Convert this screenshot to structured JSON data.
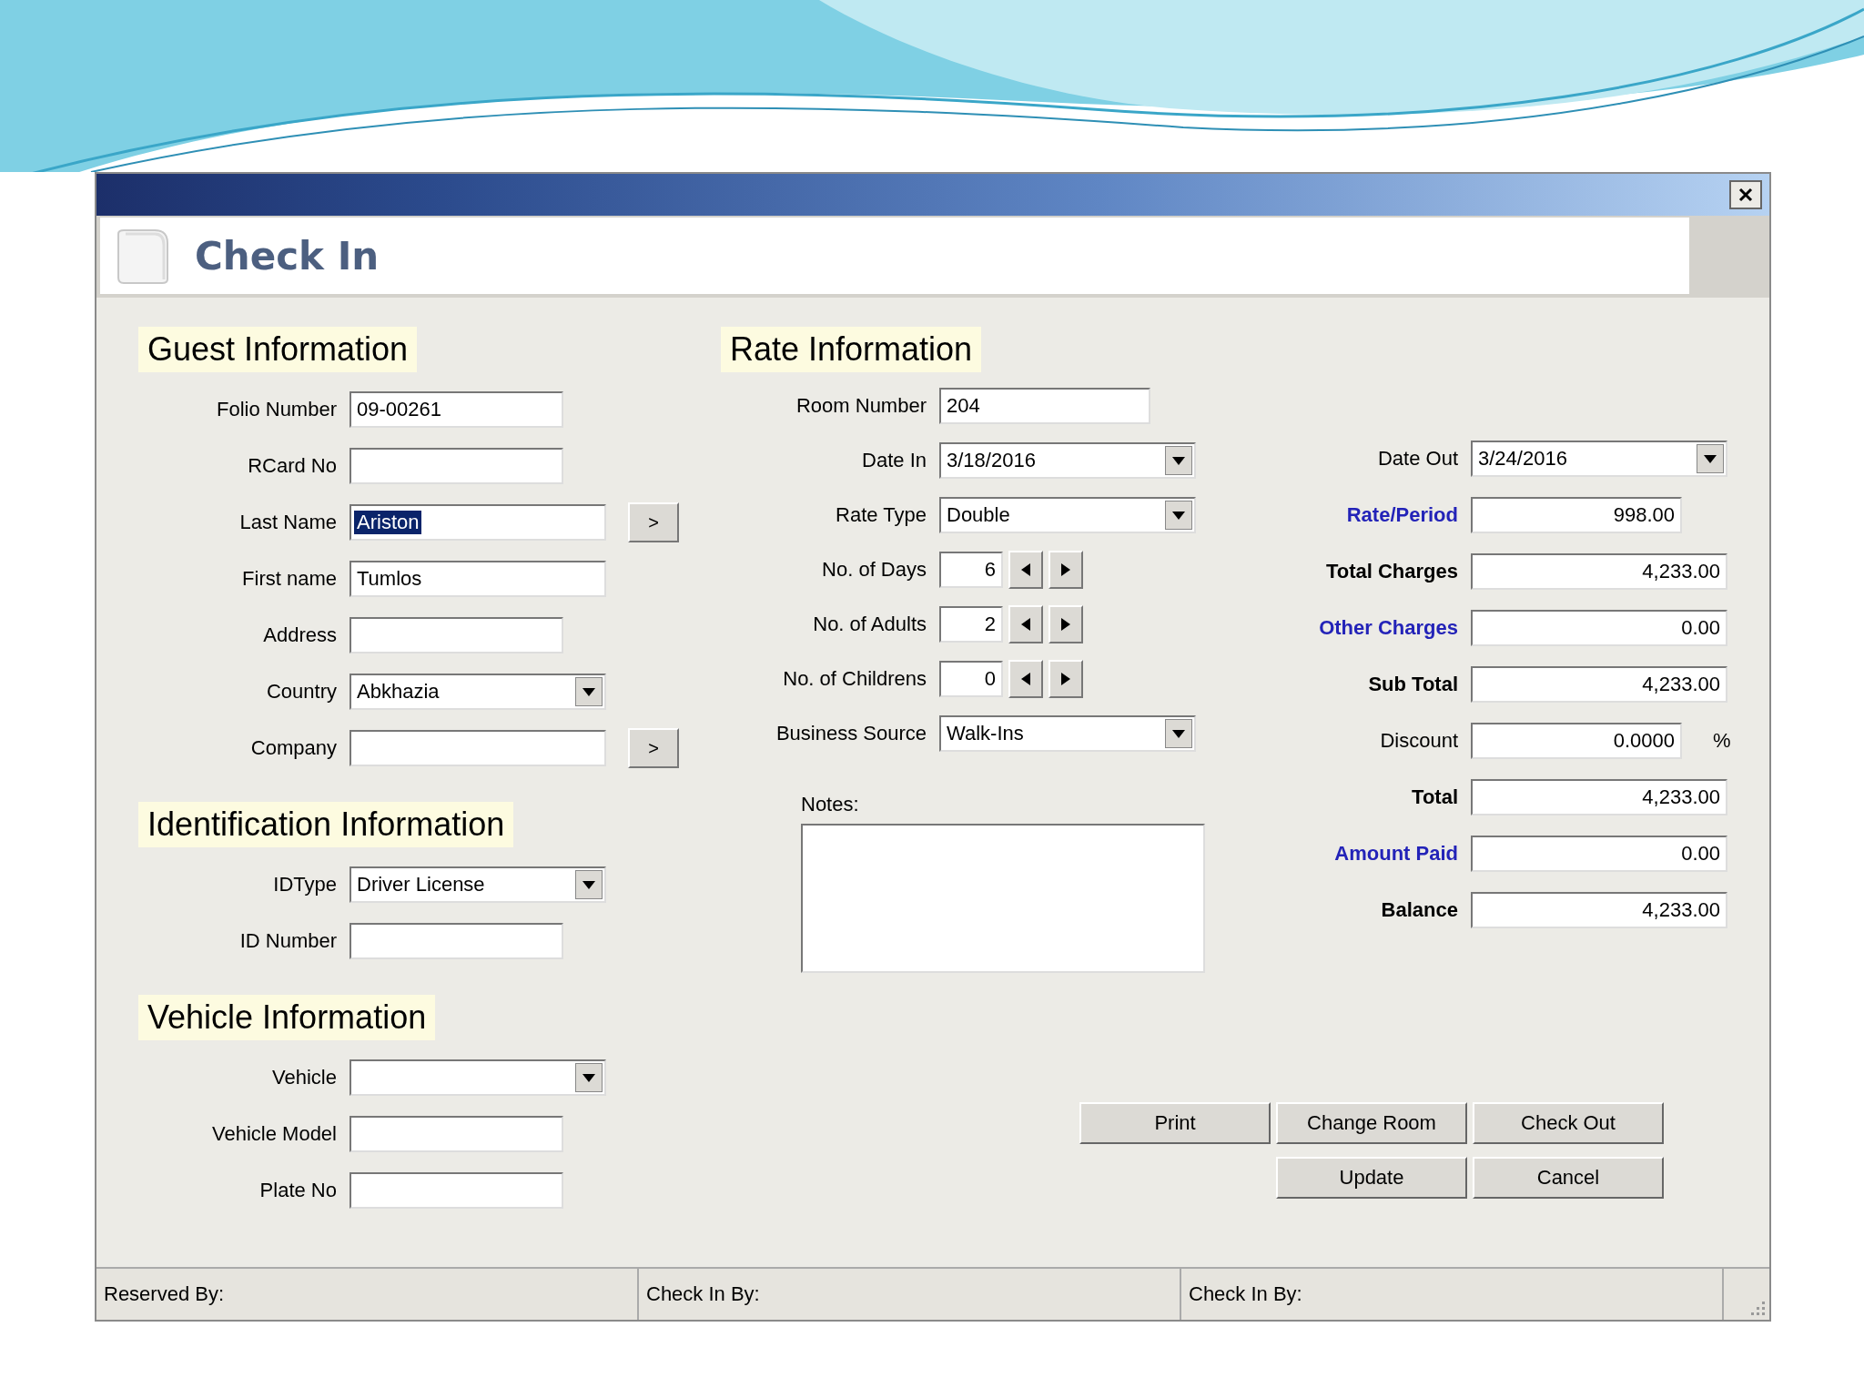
{
  "window": {
    "title": "Check In"
  },
  "guest": {
    "heading": "Guest Information",
    "fields": [
      {
        "label": "Folio Number",
        "value": "09-00261",
        "kind": "text",
        "text_selected": false
      },
      {
        "label": "RCard No",
        "kind": "text"
      },
      {
        "label": "Last Name",
        "value": "Ariston",
        "kind": "lookup",
        "button": ">",
        "text_selected": true
      },
      {
        "label": "First name",
        "value": "Tumlos",
        "kind": "text",
        "text_selected": false
      },
      {
        "label": "Address",
        "kind": "text"
      },
      {
        "label": "Country",
        "value": "Abkhazia",
        "kind": "select",
        "text_selected": false
      },
      {
        "label": "Company",
        "kind": "lookup",
        "button": ">"
      }
    ]
  },
  "identification": {
    "heading": "Identification Information",
    "fields": [
      {
        "label": "IDType",
        "value": "Driver License",
        "kind": "select",
        "text_selected": false
      },
      {
        "label": "ID Number",
        "kind": "text"
      }
    ]
  },
  "vehicle": {
    "heading": "Vehicle Information",
    "fields": [
      {
        "label": "Vehicle",
        "kind": "select"
      },
      {
        "label": "Vehicle Model",
        "kind": "text"
      },
      {
        "label": "Plate No",
        "kind": "text"
      }
    ]
  },
  "rate": {
    "heading": "Rate Information",
    "fields": [
      {
        "label": "Room Number",
        "value": "204",
        "kind": "text"
      },
      {
        "label": "Date In",
        "value": "3/18/2016",
        "kind": "select"
      },
      {
        "label": "Rate Type",
        "value": "Double",
        "kind": "select"
      },
      {
        "label": "No. of Days",
        "value": "6",
        "kind": "spinner"
      },
      {
        "label": "No. of Adults",
        "value": "2",
        "kind": "spinner"
      },
      {
        "label": "No. of Childrens",
        "value": "0",
        "kind": "spinner"
      },
      {
        "label": "Business Source",
        "value": "Walk-Ins",
        "kind": "select"
      }
    ],
    "notes_label": "Notes:"
  },
  "charges": [
    {
      "label": "Date Out",
      "value": "3/24/2016",
      "kind": "select"
    },
    {
      "label": "Rate/Period",
      "value": "998.00",
      "kind": "link"
    },
    {
      "label": "Total Charges",
      "value": "4,233.00",
      "kind": "total"
    },
    {
      "label": "Other Charges",
      "value": "0.00",
      "kind": "link"
    },
    {
      "label": "Sub Total",
      "value": "4,233.00",
      "kind": "total"
    },
    {
      "label": "Discount",
      "value": "0.0000",
      "kind": "percent",
      "suffix": "%"
    },
    {
      "label": "Total",
      "value": "4,233.00",
      "kind": "total"
    },
    {
      "label": "Amount Paid",
      "value": "0.00",
      "kind": "link"
    },
    {
      "label": "Balance",
      "value": "4,233.00",
      "kind": "total"
    }
  ],
  "buttons": [
    [
      "Print",
      "Change Room",
      "Check Out"
    ],
    [
      "Update",
      "Cancel"
    ]
  ],
  "status_bar": [
    "Reserved By:",
    "Check In By:",
    "Check In By:"
  ]
}
